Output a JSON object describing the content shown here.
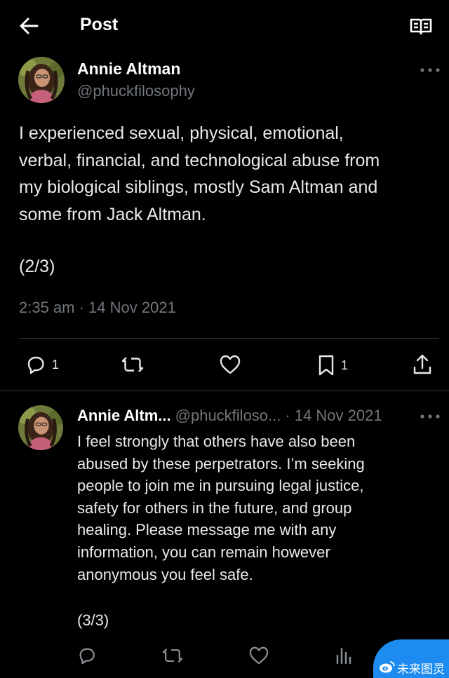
{
  "header": {
    "title": "Post",
    "back_icon": "arrow-left-icon",
    "reader_icon": "open-book-icon"
  },
  "tweet": {
    "author_name": "Annie Altman",
    "author_handle": "@phuckfilosophy",
    "body_lines": [
      "I experienced sexual, physical, emotional,",
      "verbal, financial, and technological abuse from",
      "my biological siblings, mostly Sam Altman and",
      "some from Jack Altman."
    ],
    "pager": "(2/3)",
    "timestamp": "2:35 am · 14 Nov 2021",
    "actions": {
      "reply_count": "1",
      "retweet_count": "",
      "like_count": "",
      "bookmark_count": "1"
    }
  },
  "reply": {
    "author_name": "Annie Altm...",
    "author_handle": "@phuckfiloso...",
    "date": "· 14 Nov 2021",
    "body_lines": [
      "I feel strongly that others have also been",
      "abused by these perpetrators. I’m seeking",
      "people to join me in pursuing legal justice,",
      "safety for others in the future, and group",
      "healing. Please message me with any",
      "information, you can remain however",
      "anonymous you feel safe."
    ],
    "pager": "(3/3)"
  },
  "watermark": {
    "text": "未来图灵",
    "icon": "weibo-logo-icon"
  },
  "colors": {
    "background": "#000000",
    "text": "#e7e9ea",
    "muted": "#71767b",
    "divider": "#2f3336",
    "watermark": "#1d8bf0"
  }
}
